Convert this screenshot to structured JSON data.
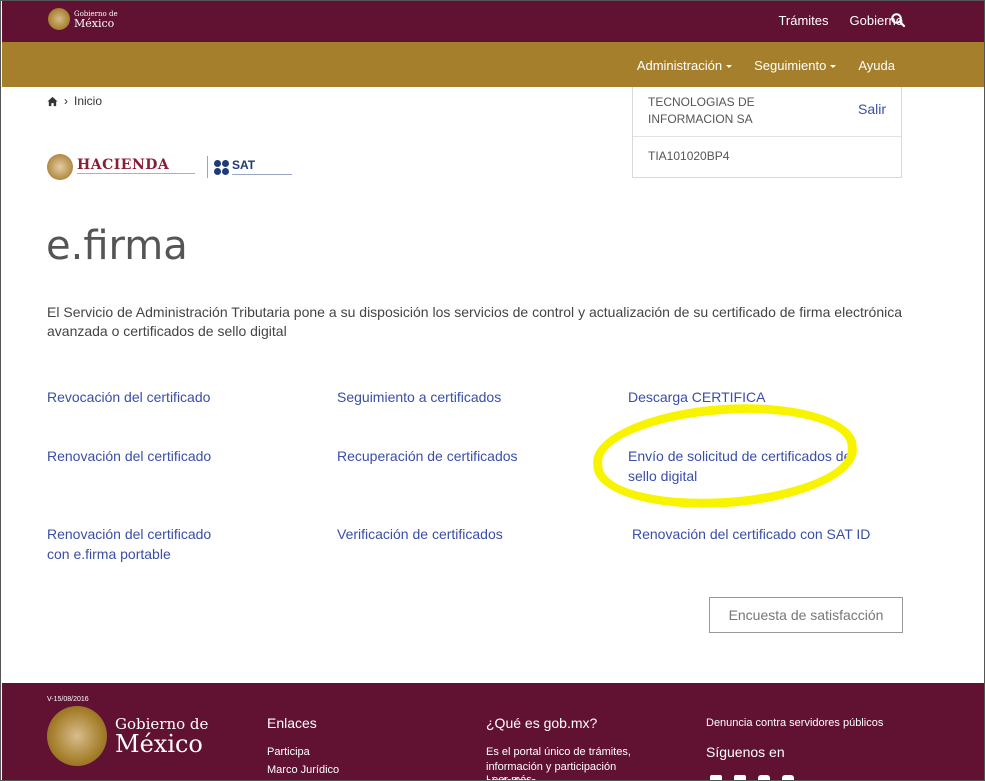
{
  "top_bar": {
    "logo_line1": "Gobierno de",
    "logo_line2": "México",
    "nav": [
      "Trámites",
      "Gobierno"
    ]
  },
  "gold_bar": {
    "menu": [
      "Administración",
      "Seguimiento",
      "Ayuda"
    ]
  },
  "breadcrumb": {
    "label": "Inicio"
  },
  "user": {
    "name": "TECNOLOGIAS DE INFORMACION SA",
    "logout": "Salir",
    "rfc": "TIA101020BP4"
  },
  "logos": {
    "hacienda": "HACIENDA",
    "sat": "SAT"
  },
  "main": {
    "title": "e.firma",
    "intro": "El Servicio de Administración Tributaria pone a su disposición los servicios de control y actualización de su certificado de firma electrónica avanzada o certificados de sello digital",
    "links": [
      "Revocación del certificado",
      "Seguimiento a certificados",
      "Descarga CERTIFICA",
      "Renovación del certificado",
      "Recuperación de certificados",
      "Envío de solicitud de certificados de sello digital",
      "Renovación del certificado con e.firma portable",
      "Verificación de certificados",
      "Renovación del certificado con SAT ID"
    ],
    "survey_button": "Encuesta de satisfacción",
    "highlight_color": "#f8f400"
  },
  "footer": {
    "version": "V-15/08/2016",
    "logo_line1": "Gobierno de",
    "logo_line2": "México",
    "enlaces_title": "Enlaces",
    "enlaces": [
      "Participa",
      "Marco Jurídico"
    ],
    "about_title": "¿Qué es gob.mx?",
    "about_text": "Es el portal único de trámites, información y participación ciudadana.",
    "about_more": "Leer más",
    "denuncia": "Denuncia contra servidores públicos",
    "siguenos": "Síguenos en"
  },
  "colors": {
    "top_bar": "#611232",
    "gold_bar": "#a57f2c",
    "link": "#3a4ea8"
  }
}
